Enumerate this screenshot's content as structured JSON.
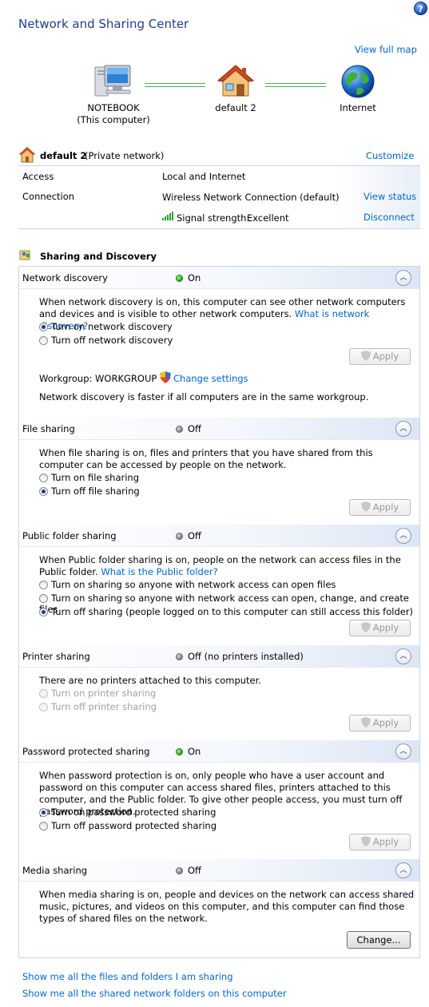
{
  "title": "Network and Sharing Center",
  "view_full_map": "View full map",
  "map": {
    "computer_name": "NOTEBOOK",
    "computer_sub": "(This computer)",
    "network_name": "default  2",
    "internet": "Internet"
  },
  "network": {
    "name": "default  2",
    "type": "(Private network)",
    "customize": "Customize",
    "access_label": "Access",
    "access_value": "Local and Internet",
    "connection_label": "Connection",
    "connection_value": "Wireless Network Connection (default)",
    "view_status": "View status",
    "signal_label": "Signal strength:",
    "signal_value": "Excellent",
    "disconnect": "Disconnect"
  },
  "sharing": {
    "title": "Sharing and Discovery",
    "apply_label": "Apply",
    "change_label": "Change...",
    "network_discovery": {
      "name": "Network discovery",
      "status": "On",
      "desc": "When network discovery is on, this computer can see other network computers and devices and is visible to other network computers.",
      "link": "What is network discovery?",
      "opt_on": "Turn on network discovery",
      "opt_off": "Turn off network discovery",
      "workgroup": "Workgroup: WORKGROUP",
      "change_settings": "Change settings",
      "note": "Network discovery is faster if all computers are in the same workgroup."
    },
    "file_sharing": {
      "name": "File sharing",
      "status": "Off",
      "desc": "When file sharing is on, files and printers that you have shared from this computer can be accessed by people on the network.",
      "opt_on": "Turn on file sharing",
      "opt_off": "Turn off file sharing"
    },
    "public_folder": {
      "name": "Public folder sharing",
      "status": "Off",
      "desc": "When Public folder sharing is on, people on the network can access files in the Public folder.",
      "link": "What is the Public folder?",
      "opt_1": "Turn on sharing so anyone with network access can open files",
      "opt_2": "Turn on sharing so anyone with network access can open, change, and create files",
      "opt_3": "Turn off sharing (people logged on to this computer can still access this folder)"
    },
    "printer_sharing": {
      "name": "Printer sharing",
      "status": "Off (no printers installed)",
      "desc": "There are no printers attached to this computer.",
      "opt_on": "Turn on printer sharing",
      "opt_off": "Turn off printer sharing"
    },
    "password_sharing": {
      "name": "Password protected sharing",
      "status": "On",
      "desc": "When password protection is on, only people who have a user account and password on this computer can access shared files, printers attached to this computer, and the Public folder. To give other people access, you must turn off password protection.",
      "opt_on": "Turn on password protected sharing",
      "opt_off": "Turn off password protected sharing"
    },
    "media_sharing": {
      "name": "Media sharing",
      "status": "Off",
      "desc": "When media sharing is on, people and devices on the network can access shared music, pictures, and videos on this computer, and this computer can find those types of shared files on the network."
    }
  },
  "bottom_links": {
    "files": "Show me all the files and folders I am sharing",
    "folders": "Show me all the shared network folders on this computer"
  },
  "colors": {
    "title_blue": "#1e3d8a",
    "link_blue": "#0066cc",
    "status_green": "#22a00e"
  }
}
